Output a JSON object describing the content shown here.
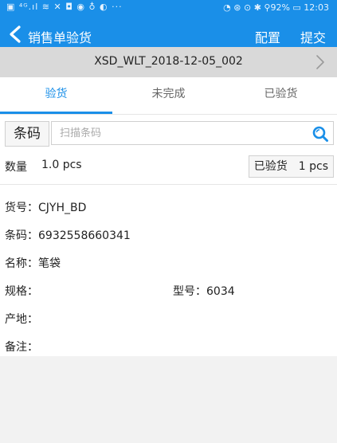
{
  "status_bar": {
    "left_icons": "▣ ⁴ᴳ.ıl ≋ ✕ ◘ ◉ ♁ ◐ ···",
    "right_text": "◔ ⊛ ⊙ ✱ ⚲92% ▭ 12:03"
  },
  "nav": {
    "title": "销售单验货",
    "config_label": "配置",
    "submit_label": "提交"
  },
  "doc": {
    "number": "XSD_WLT_2018-12-05_002"
  },
  "tabs": [
    {
      "label": "验货",
      "active": true
    },
    {
      "label": "未完成",
      "active": false
    },
    {
      "label": "已验货",
      "active": false
    }
  ],
  "scan": {
    "label": "条码",
    "placeholder": "扫描条码",
    "value": ""
  },
  "quantity": {
    "label": "数量",
    "value": "1.0 pcs",
    "checked_label": "已验货",
    "checked_value": "1 pcs"
  },
  "details": {
    "item_no_label": "货号：",
    "item_no": "CJYH_BD",
    "barcode_label": "条码：",
    "barcode": "6932558660341",
    "name_label": "名称：",
    "name": "笔袋",
    "spec_label": "规格：",
    "spec": "",
    "model_label": "型号：",
    "model": "6034",
    "origin_label": "产地：",
    "origin": "",
    "remark_label": "备注：",
    "remark": ""
  },
  "colors": {
    "accent": "#1a8fe8",
    "doc_bar": "#d9d9d9",
    "background": "#f2f2f2"
  },
  "icons": {
    "back": "chevron-left-icon",
    "doc_next": "chevron-right-icon",
    "search": "search-icon"
  }
}
